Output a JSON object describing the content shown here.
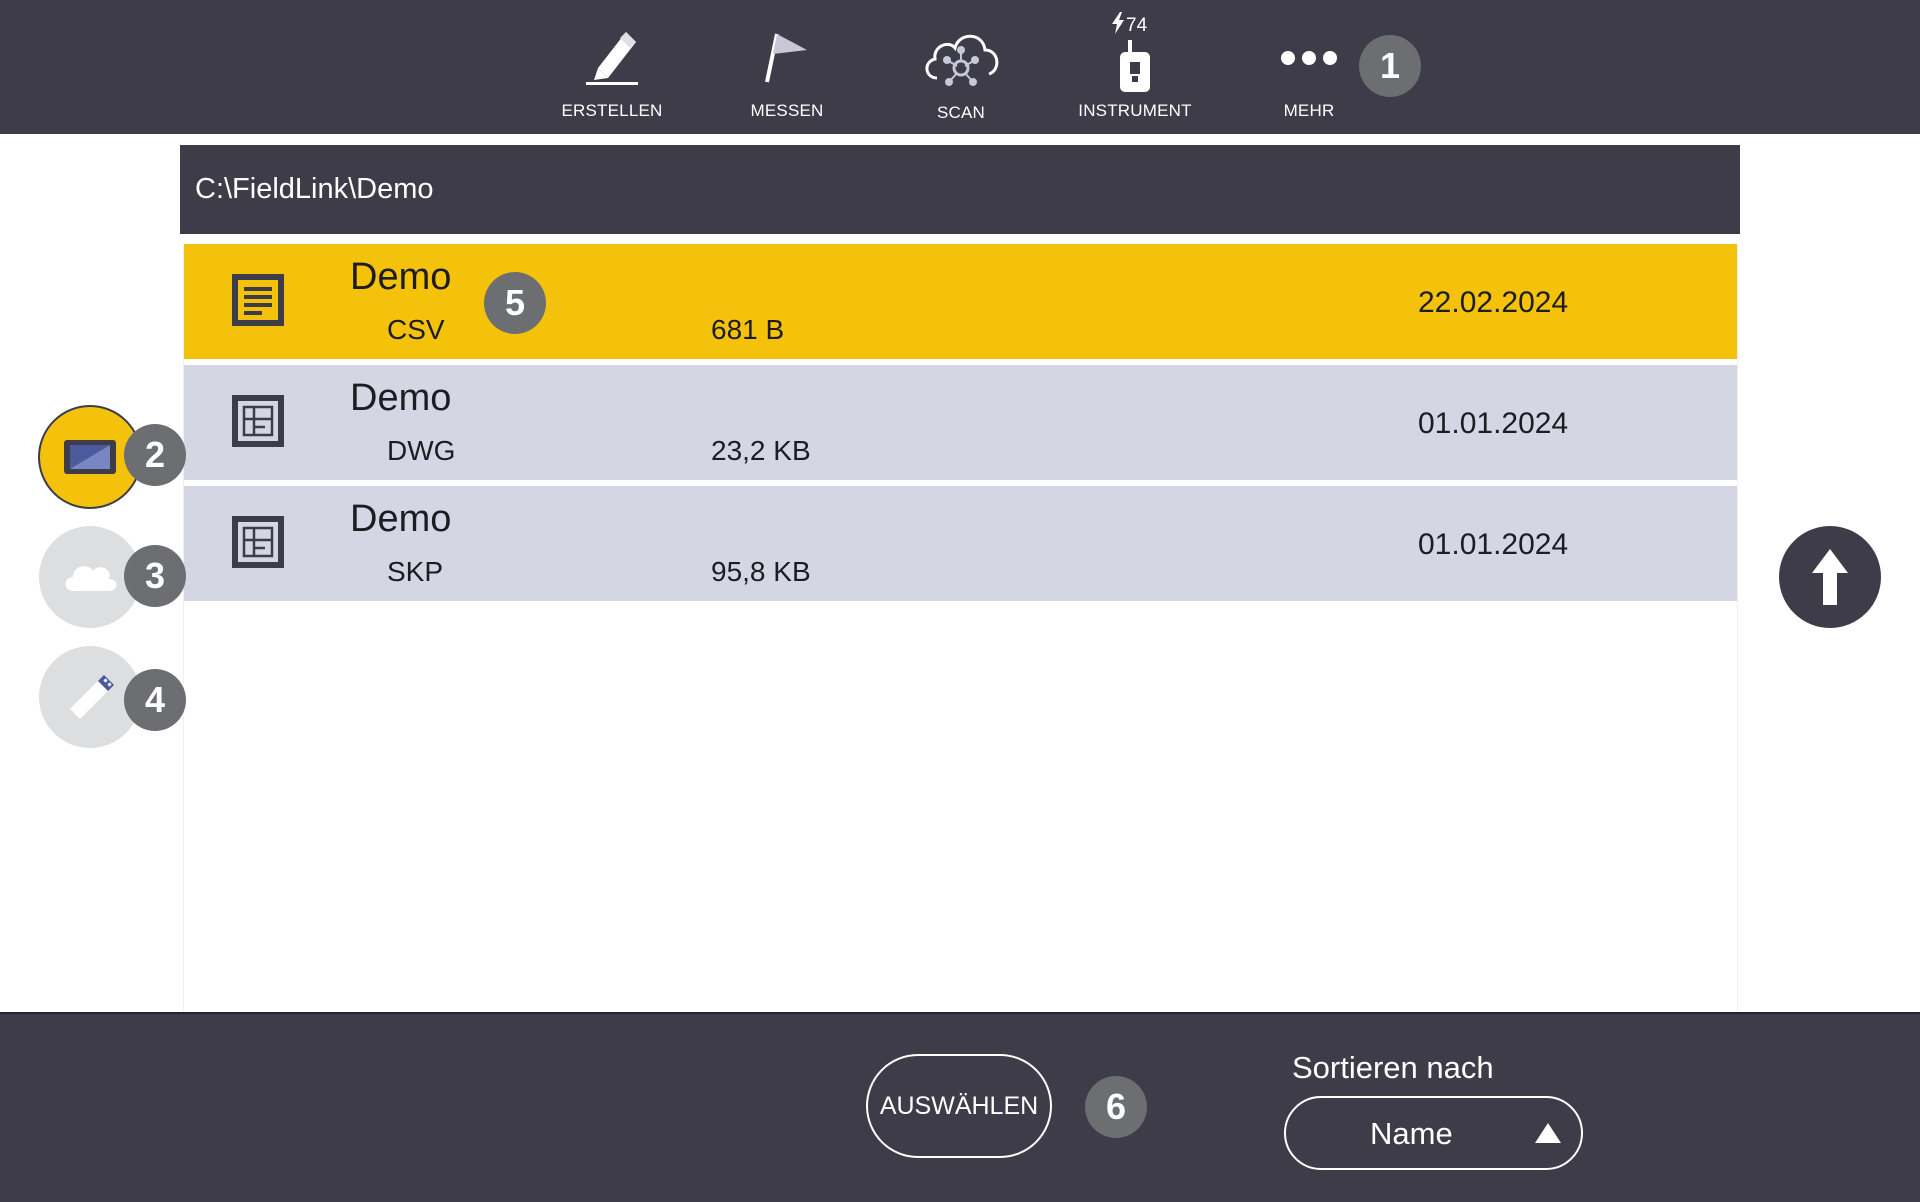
{
  "toolbar": {
    "items": [
      {
        "label": "ERSTELLEN",
        "icon": "pencil-icon"
      },
      {
        "label": "MESSEN",
        "icon": "flag-icon"
      },
      {
        "label": "SCAN",
        "icon": "cloud-scan-icon"
      },
      {
        "label": "INSTRUMENT",
        "icon": "instrument-icon"
      },
      {
        "label": "MEHR",
        "icon": "more-dots-icon"
      }
    ],
    "battery_value": "74"
  },
  "callouts": [
    "1",
    "2",
    "3",
    "4",
    "5",
    "6"
  ],
  "path": "C:\\FieldLink\\Demo",
  "files": [
    {
      "name": "Demo",
      "type": "CSV",
      "size": "681 B",
      "date": "22.02.2024",
      "selected": true,
      "icon": "text-file-icon"
    },
    {
      "name": "Demo",
      "type": "DWG",
      "size": "23,2 KB",
      "date": "01.01.2024",
      "selected": false,
      "icon": "drawing-file-icon"
    },
    {
      "name": "Demo",
      "type": "SKP",
      "size": "95,8 KB",
      "date": "01.01.2024",
      "selected": false,
      "icon": "drawing-file-icon"
    }
  ],
  "locations": [
    {
      "icon": "tablet-icon",
      "active": true
    },
    {
      "icon": "cloud-icon",
      "active": false
    },
    {
      "icon": "usb-drive-icon",
      "active": false
    }
  ],
  "bottom": {
    "select_label": "AUSWÄHLEN",
    "sort_label": "Sortieren nach",
    "sort_value": "Name"
  },
  "colors": {
    "bar": "#3d3c48",
    "accent": "#f4c20a",
    "row": "#d5d6e3",
    "callout": "#6c6e72"
  }
}
